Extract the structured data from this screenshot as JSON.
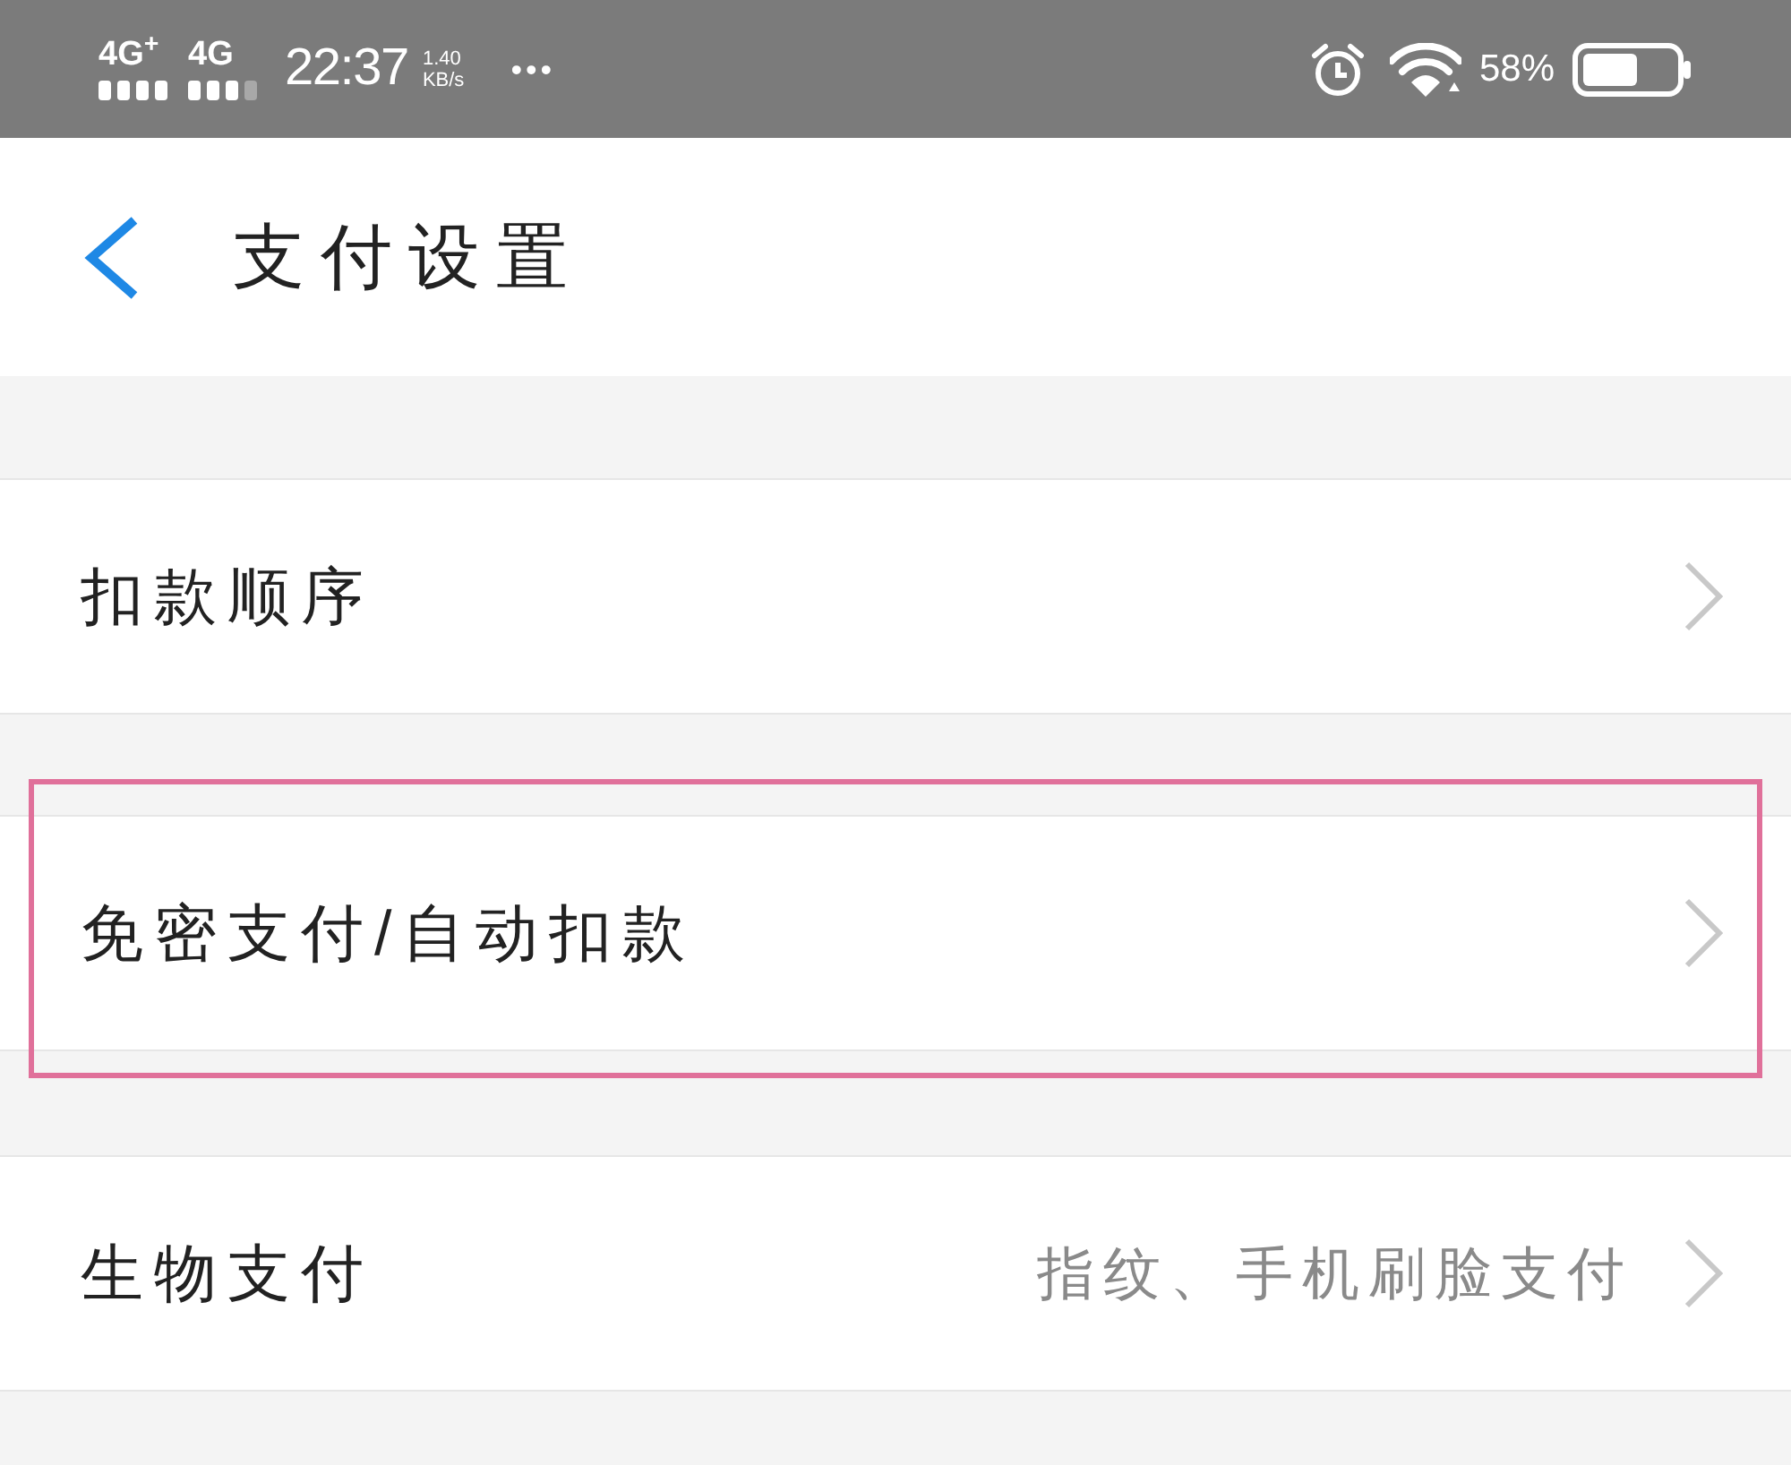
{
  "status_bar": {
    "networks": [
      {
        "label": "4G$^{+}$"
      },
      {
        "label": "4G"
      }
    ],
    "time": "22:37",
    "data_rate": "1.40",
    "data_rate_unit": "KB/s",
    "more": "•••",
    "battery_percent": "58%"
  },
  "header": {
    "title": "支付设置"
  },
  "rows": [
    {
      "label": "扣款顺序",
      "highlighted": false
    },
    {
      "label": "免密支付/自动扣款",
      "highlighted": true
    },
    {
      "label": "生物支付",
      "detail": "指纹、手机刷脸支付",
      "highlighted": false
    }
  ]
}
